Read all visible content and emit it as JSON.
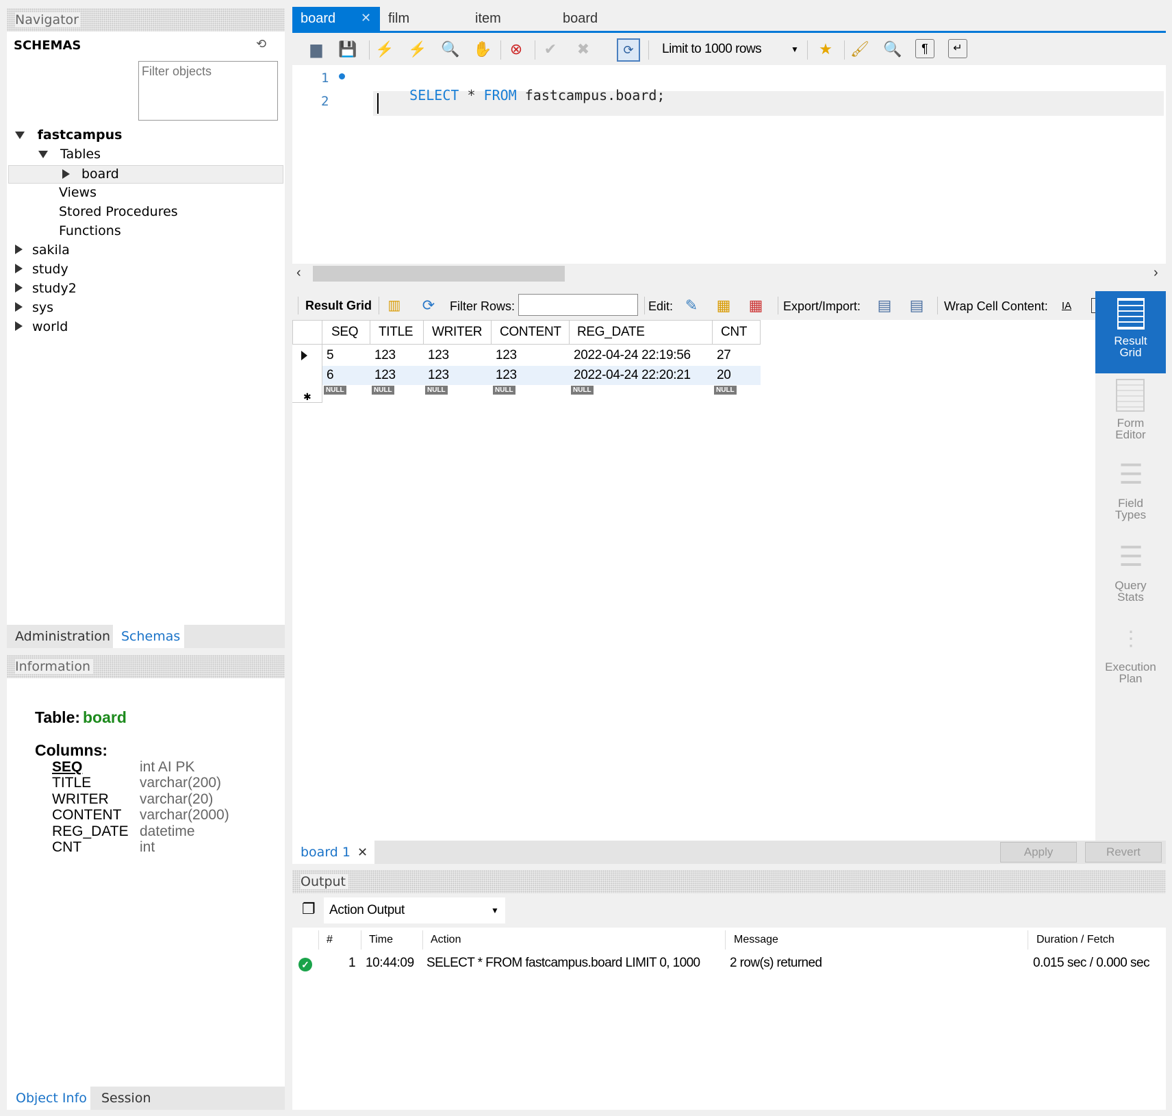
{
  "navigator": {
    "header": "Navigator",
    "schemas_label": "SCHEMAS",
    "filter_placeholder": "Filter objects",
    "tree": {
      "schema_open": "fastcampus",
      "tables": "Tables",
      "table_selected": "board",
      "views": "Views",
      "procedures": "Stored Procedures",
      "functions": "Functions",
      "other_schemas": [
        "sakila",
        "study",
        "study2",
        "sys",
        "world"
      ]
    },
    "tabs": {
      "administration": "Administration",
      "schemas": "Schemas"
    }
  },
  "information": {
    "header": "Information",
    "table_label": "Table:",
    "table_name": "board",
    "columns_label": "Columns:",
    "columns": [
      {
        "name": "SEQ",
        "type": "int AI PK"
      },
      {
        "name": "TITLE",
        "type": "varchar(200)"
      },
      {
        "name": "WRITER",
        "type": "varchar(20)"
      },
      {
        "name": "CONTENT",
        "type": "varchar(2000)"
      },
      {
        "name": "REG_DATE",
        "type": "datetime"
      },
      {
        "name": "CNT",
        "type": "int"
      }
    ],
    "tabs": {
      "object_info": "Object Info",
      "session": "Session"
    }
  },
  "editor_tabs": [
    "board",
    "film",
    "item",
    "board"
  ],
  "toolbar": {
    "limit": "Limit to 1000 rows"
  },
  "editor": {
    "lines": [
      {
        "num": "1",
        "kw1": "SELECT",
        "star": " * ",
        "kw2": "FROM",
        "rest": " fastcampus.board;"
      },
      {
        "num": "2"
      }
    ]
  },
  "result_toolbar": {
    "result_grid": "Result Grid",
    "filter_rows": "Filter Rows:",
    "edit": "Edit:",
    "export": "Export/Import:",
    "wrap": "Wrap Cell Content:"
  },
  "grid": {
    "columns": [
      "SEQ",
      "TITLE",
      "WRITER",
      "CONTENT",
      "REG_DATE",
      "CNT"
    ],
    "rows": [
      [
        "5",
        "123",
        "123",
        "123",
        "2022-04-24 22:19:56",
        "27"
      ],
      [
        "6",
        "123",
        "123",
        "123",
        "2022-04-24 22:20:21",
        "20"
      ]
    ],
    "null_label": "NULL"
  },
  "side_panel": {
    "result_grid": "Result Grid",
    "form_editor": "Form Editor",
    "field_types": "Field Types",
    "query_stats": "Query Stats",
    "execution_plan": "Execution Plan"
  },
  "result_tab": {
    "label": "board 1",
    "apply": "Apply",
    "revert": "Revert"
  },
  "output": {
    "header": "Output",
    "selector": "Action Output",
    "columns": {
      "num": "#",
      "time": "Time",
      "action": "Action",
      "message": "Message",
      "duration": "Duration / Fetch"
    },
    "rows": [
      {
        "num": "1",
        "time": "10:44:09",
        "action": "SELECT * FROM fastcampus.board LIMIT 0, 1000",
        "message": "2 row(s) returned",
        "duration": "0.015 sec / 0.000 sec"
      }
    ]
  },
  "colors": {
    "accent": "#0078d7",
    "selection": "#cce8ff",
    "green": "#1c8a1c"
  }
}
